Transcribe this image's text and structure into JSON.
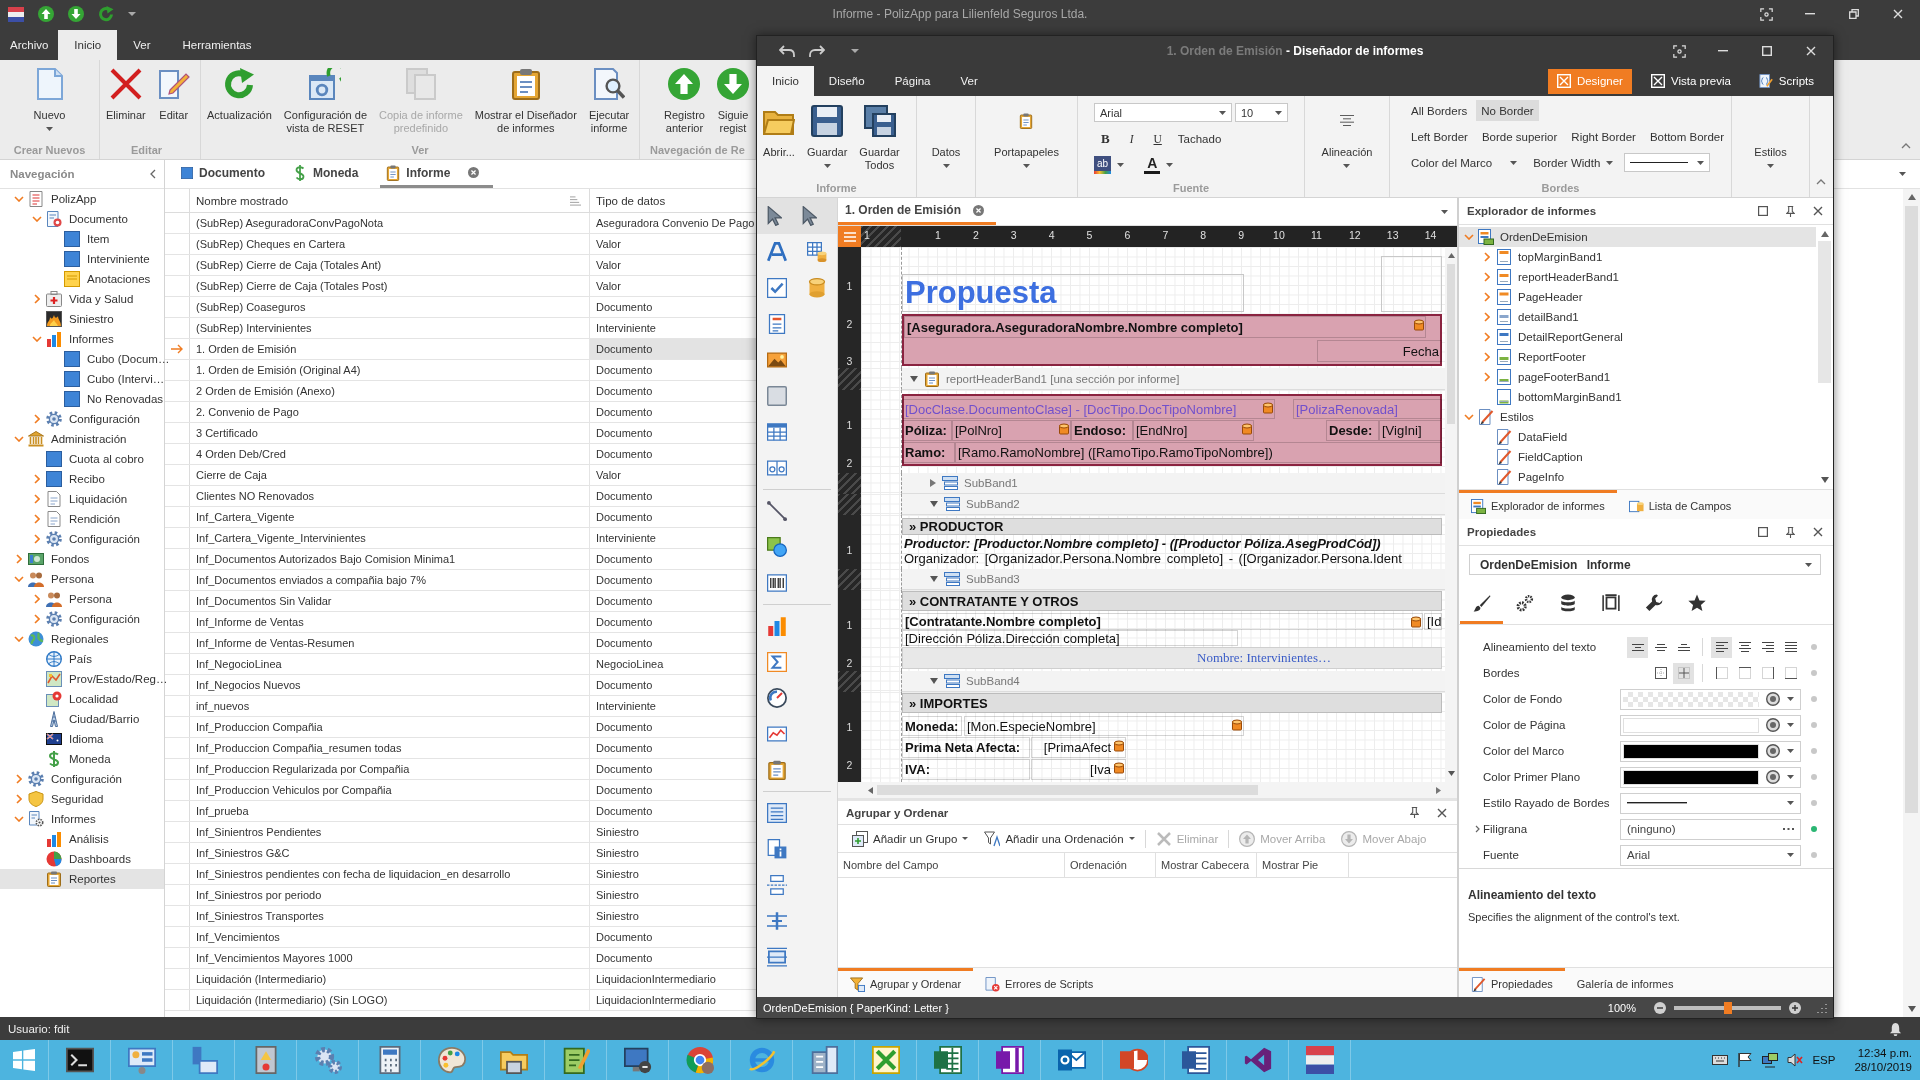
{
  "main_window": {
    "title": "Informe - PolizApp para Lilienfeld Seguros Ltda.",
    "ribbon_tabs": [
      {
        "label": "Archivo",
        "selected": false
      },
      {
        "label": "Inicio",
        "selected": true
      },
      {
        "label": "Ver",
        "selected": false
      },
      {
        "label": "Herramientas",
        "selected": false
      }
    ],
    "ribbon_groups": [
      {
        "title": "Crear Nuevos",
        "buttons": [
          {
            "label": "Nuevo",
            "dropdown": true,
            "disabled": false
          }
        ]
      },
      {
        "title": "Editar",
        "buttons": [
          {
            "label": "Eliminar",
            "disabled": false
          },
          {
            "label": "Editar",
            "disabled": false
          }
        ]
      },
      {
        "title": "Ver",
        "buttons": [
          {
            "label": "Actualización",
            "disabled": false
          },
          {
            "label": "Configuración de\nvista de RESET",
            "disabled": false
          },
          {
            "label": "Copia de informe\npredefinido",
            "disabled": true
          },
          {
            "label": "Mostrar el Diseñador\nde informes",
            "disabled": false
          },
          {
            "label": "Ejecutar\ninforme",
            "disabled": false
          }
        ]
      },
      {
        "title": "Navegación de Re",
        "buttons": [
          {
            "label": "Registro\nanterior",
            "disabled": false
          },
          {
            "label": "Siguie\nregist",
            "disabled": false
          }
        ]
      }
    ],
    "navigation": {
      "title": "Navegación",
      "tree": [
        {
          "label": "PolizApp",
          "expanded": true,
          "selected": false,
          "children": [
            {
              "label": "Documento",
              "expanded": true,
              "selected": false,
              "children": [
                {
                  "label": "Item",
                  "selected": false
                },
                {
                  "label": "Interviniente",
                  "selected": false
                },
                {
                  "label": "Anotaciones",
                  "selected": false
                }
              ]
            },
            {
              "label": "Vida y Salud",
              "expanded": false,
              "selected": false
            },
            {
              "label": "Siniestro",
              "selected": false
            },
            {
              "label": "Informes",
              "expanded": true,
              "selected": false,
              "children": [
                {
                  "label": "Cubo (Docum…",
                  "selected": false
                },
                {
                  "label": "Cubo (Intervi…",
                  "selected": false
                },
                {
                  "label": "No Renovadas",
                  "selected": false
                }
              ]
            },
            {
              "label": "Configuración",
              "expanded": false,
              "selected": false
            }
          ]
        },
        {
          "label": "Administración",
          "expanded": true,
          "selected": false,
          "children": [
            {
              "label": "Cuota al cobro",
              "selected": false
            },
            {
              "label": "Recibo",
              "expanded": false,
              "selected": false
            },
            {
              "label": "Liquidación",
              "expanded": false,
              "selected": false
            },
            {
              "label": "Rendición",
              "expanded": false,
              "selected": false
            },
            {
              "label": "Configuración",
              "expanded": false,
              "selected": false
            }
          ]
        },
        {
          "label": "Fondos",
          "expanded": false,
          "selected": false
        },
        {
          "label": "Persona",
          "expanded": true,
          "selected": false,
          "children": [
            {
              "label": "Persona",
              "expanded": false,
              "selected": false
            },
            {
              "label": "Configuración",
              "expanded": false,
              "selected": false
            }
          ]
        },
        {
          "label": "Regionales",
          "expanded": true,
          "selected": false,
          "children": [
            {
              "label": "País",
              "selected": false
            },
            {
              "label": "Prov/Estado/Reg…",
              "selected": false
            },
            {
              "label": "Localidad",
              "selected": false
            },
            {
              "label": "Ciudad/Barrio",
              "selected": false
            },
            {
              "label": "Idioma",
              "selected": false
            },
            {
              "label": "Moneda",
              "selected": false
            }
          ]
        },
        {
          "label": "Configuración",
          "expanded": false,
          "selected": false
        },
        {
          "label": "Seguridad",
          "expanded": false,
          "selected": false
        },
        {
          "label": "Informes",
          "expanded": true,
          "selected": false,
          "children": [
            {
              "label": "Análisis",
              "selected": false
            },
            {
              "label": "Dashboards",
              "selected": false
            },
            {
              "label": "Reportes",
              "selected": true
            }
          ]
        }
      ]
    },
    "document_tabs": [
      {
        "label": "Documento",
        "selected": false,
        "closable": false
      },
      {
        "label": "Moneda",
        "selected": false,
        "closable": false
      },
      {
        "label": "Informe",
        "selected": true,
        "closable": true
      }
    ],
    "grid": {
      "columns": [
        "Nombre mostrado",
        "Tipo de datos"
      ],
      "rows": [
        {
          "name": "(SubRep) AseguradoraConvPagoNota",
          "type": "Aseguradora Convenio De Pago",
          "selected": false
        },
        {
          "name": "(SubRep) Cheques en Cartera",
          "type": "Valor",
          "selected": false
        },
        {
          "name": "(SubRep) Cierre de Caja (Totales Ant)",
          "type": "Valor",
          "selected": false
        },
        {
          "name": "(SubRep) Cierre de Caja (Totales Post)",
          "type": "Valor",
          "selected": false
        },
        {
          "name": "(SubRep) Coaseguros",
          "type": "Documento",
          "selected": false
        },
        {
          "name": "(SubRep) Intervinientes",
          "type": "Interviniente",
          "selected": false
        },
        {
          "name": "1. Orden de Emisión",
          "type": "Documento",
          "selected": true
        },
        {
          "name": "1. Orden de Emisión (Original A4)",
          "type": "Documento",
          "selected": false
        },
        {
          "name": "2 Orden de Emisión (Anexo)",
          "type": "Documento",
          "selected": false
        },
        {
          "name": "2. Convenio de Pago",
          "type": "Documento",
          "selected": false
        },
        {
          "name": "3 Certificado",
          "type": "Documento",
          "selected": false
        },
        {
          "name": "4 Orden Deb/Cred",
          "type": "Documento",
          "selected": false
        },
        {
          "name": "Cierre de Caja",
          "type": "Valor",
          "selected": false
        },
        {
          "name": "Clientes NO Renovados",
          "type": "Documento",
          "selected": false
        },
        {
          "name": "Inf_Cartera_Vigente",
          "type": "Documento",
          "selected": false
        },
        {
          "name": "Inf_Cartera_Vigente_Intervinientes",
          "type": "Interviniente",
          "selected": false
        },
        {
          "name": "Inf_Documentos Autorizados Bajo Comision Minima1",
          "type": "Documento",
          "selected": false
        },
        {
          "name": "Inf_Documentos enviados a compañia bajo 7%",
          "type": "Documento",
          "selected": false
        },
        {
          "name": "Inf_Documentos Sin Validar",
          "type": "Documento",
          "selected": false
        },
        {
          "name": "Inf_Informe de Ventas",
          "type": "Documento",
          "selected": false
        },
        {
          "name": "Inf_Informe de Ventas-Resumen",
          "type": "Documento",
          "selected": false
        },
        {
          "name": "Inf_NegocioLinea",
          "type": "NegocioLinea",
          "selected": false
        },
        {
          "name": "Inf_Negocios Nuevos",
          "type": "Documento",
          "selected": false
        },
        {
          "name": "inf_nuevos",
          "type": "Interviniente",
          "selected": false
        },
        {
          "name": "Inf_Produccion Compañia",
          "type": "Documento",
          "selected": false
        },
        {
          "name": "Inf_Produccion Compañia_resumen todas",
          "type": "Documento",
          "selected": false
        },
        {
          "name": "Inf_Produccion Regularizada por Compañia",
          "type": "Documento",
          "selected": false
        },
        {
          "name": "Inf_Produccion Vehiculos por Compañia",
          "type": "Documento",
          "selected": false
        },
        {
          "name": "Inf_prueba",
          "type": "Documento",
          "selected": false
        },
        {
          "name": "Inf_Sinientros Pendientes",
          "type": "Siniestro",
          "selected": false
        },
        {
          "name": "Inf_Siniestros G&C",
          "type": "Siniestro",
          "selected": false
        },
        {
          "name": "Inf_Siniestros pendientes con fecha de liquidacion_en desarrollo",
          "type": "Siniestro",
          "selected": false
        },
        {
          "name": "Inf_Siniestros por periodo",
          "type": "Siniestro",
          "selected": false
        },
        {
          "name": "Inf_Siniestros Transportes",
          "type": "Siniestro",
          "selected": false
        },
        {
          "name": "Inf_Vencimientos",
          "type": "Documento",
          "selected": false
        },
        {
          "name": "Inf_Vencimientos Mayores 1000",
          "type": "Documento",
          "selected": false
        },
        {
          "name": "Liquidación (Intermediario)",
          "type": "LiquidacionIntermediario",
          "selected": false
        },
        {
          "name": "Liquidación (Intermediario) (Sin LOGO)",
          "type": "LiquidacionIntermediario",
          "selected": false
        }
      ]
    },
    "status_bar": "Usuario: fdit"
  },
  "designer_window": {
    "title": {
      "document": "1. Orden de Emisión",
      "application": "- Diseñador de informes"
    },
    "tabs": [
      {
        "label": "Inicio",
        "selected": true
      },
      {
        "label": "Diseño",
        "selected": false
      },
      {
        "label": "Página",
        "selected": false
      },
      {
        "label": "Ver",
        "selected": false
      }
    ],
    "view_modes": [
      {
        "label": "Designer",
        "selected": true
      },
      {
        "label": "Vista previa",
        "selected": false
      },
      {
        "label": "Scripts",
        "selected": false
      }
    ],
    "ribbon_groups": [
      {
        "kind": "buttons",
        "title": "Informe",
        "buttons": [
          {
            "label": "Abrir..."
          },
          {
            "label": "Guardar",
            "dropdown": true
          },
          {
            "label": "Guardar\nTodos"
          }
        ]
      },
      {
        "kind": "buttons",
        "buttons": [
          {
            "label": "Datos",
            "dropdown": true
          }
        ]
      },
      {
        "kind": "buttons",
        "buttons": [
          {
            "label": "Portapapeles",
            "dropdown": true
          }
        ]
      },
      {
        "kind": "font",
        "title": "Fuente",
        "font": "Arial",
        "size": "10",
        "styles": [
          "B",
          "I",
          "U",
          "Tachado"
        ],
        "highlight_label": "ab",
        "font_color_label": "A"
      },
      {
        "kind": "buttons",
        "buttons": [
          {
            "label": "Alineación",
            "dropdown": true
          }
        ]
      },
      {
        "kind": "borders",
        "title": "Bordes",
        "presets": [
          {
            "label": "All Borders",
            "selected": false
          },
          {
            "label": "No Border",
            "selected": true
          }
        ],
        "sides": [
          "Left Border",
          "Borde superior",
          "Right Border",
          "Bottom Border"
        ],
        "menus": [
          "Color del Marco",
          "Border Width"
        ]
      },
      {
        "kind": "buttons",
        "buttons": [
          {
            "label": "Estilos",
            "dropdown": true
          }
        ]
      }
    ],
    "surface": {
      "tab": {
        "label": "1. Orden de Emisión",
        "selected": true
      },
      "ruler": [
        "1",
        "1",
        "2",
        "3",
        "4",
        "5",
        "6",
        "7",
        "8",
        "9",
        "10",
        "11",
        "12",
        "13",
        "14"
      ],
      "top_section": {
        "ruler": [
          "1",
          "2",
          "3"
        ],
        "controls": [
          {
            "kind": "title",
            "text": "Propuesta"
          },
          {
            "kind": "frame"
          },
          {
            "kind": "panel"
          },
          {
            "kind": "strong",
            "text": "[Aseguradora.AseguradoraNombre.Nombre completo]",
            "bound": true
          },
          {
            "kind": "text",
            "text": "Fecha",
            "align_right": true
          }
        ]
      },
      "bands": [
        {
          "label": "reportHeaderBand1 [una sección por informe]",
          "expanded": true,
          "ruler": [
            "1",
            "2"
          ],
          "controls": [
            {
              "kind": "panel"
            },
            {
              "kind": "expression",
              "text": "[DocClase.DocumentoClase] - [DocTipo.DocTipoNombre]",
              "bound": true
            },
            {
              "kind": "expression",
              "text": "[PolizaRenovada]"
            },
            {
              "kind": "strong",
              "text": "Póliza:"
            },
            {
              "kind": "text",
              "text": "[PolNro]",
              "bound": true
            },
            {
              "kind": "strong",
              "text": "Endoso:"
            },
            {
              "kind": "text",
              "text": "[EndNro]",
              "bound": true
            },
            {
              "kind": "strong",
              "text": "Desde:"
            },
            {
              "kind": "text",
              "text": "[VigIni]"
            },
            {
              "kind": "strong",
              "text": "Ramo:"
            },
            {
              "kind": "text",
              "text": "[Ramo.RamoNombre] ([RamoTipo.RamoTipoNombre])"
            }
          ],
          "sub_bands": [
            {
              "label": "SubBand1",
              "expanded": false
            },
            {
              "label": "SubBand2",
              "expanded": true,
              "ruler": [
                "1"
              ],
              "controls": [
                {
                  "kind": "heading",
                  "text": "» PRODUCTOR"
                },
                {
                  "kind": "italic",
                  "text": "Productor: [Productor.Nombre completo] - ([Productor Póliza.AsegProdCód])"
                },
                {
                  "kind": "plain",
                  "text": "Organizador: [Organizador.Persona.Nombre completo] - ([Organizador.Persona.Ident"
                }
              ]
            },
            {
              "label": "SubBand3",
              "expanded": true,
              "ruler": [
                "1",
                "2"
              ],
              "controls": [
                {
                  "kind": "heading",
                  "text": "» CONTRATANTE Y OTROS"
                },
                {
                  "kind": "strong",
                  "text": "[Contratante.Nombre completo]",
                  "bound": true
                },
                {
                  "kind": "text",
                  "text": "[Id"
                },
                {
                  "kind": "text",
                  "text": "[Dirección Póliza.Dirección completa]"
                },
                {
                  "kind": "serif",
                  "text": "Nombre: Intervinientes…"
                }
              ]
            },
            {
              "label": "SubBand4",
              "expanded": true,
              "ruler": [
                "1",
                "2"
              ],
              "controls": [
                {
                  "kind": "heading",
                  "text": "» IMPORTES"
                },
                {
                  "kind": "strong",
                  "text": "Moneda:"
                },
                {
                  "kind": "text",
                  "text": "[Mon.EspecieNombre]",
                  "bound": true
                },
                {
                  "kind": "strong",
                  "text": "Prima Neta Afecta:"
                },
                {
                  "kind": "text",
                  "text": "[PrimaAfect",
                  "align_right": true,
                  "bound": true
                },
                {
                  "kind": "strong",
                  "text": "IVA:"
                },
                {
                  "kind": "text",
                  "text": "[Iva",
                  "align_right": true,
                  "bound": true
                }
              ]
            }
          ]
        }
      ]
    },
    "group_sort": {
      "title": "Agrupar y Ordenar",
      "toolbar": [
        {
          "label": "Añadir un Grupo",
          "dropdown": true,
          "disabled": false
        },
        {
          "label": "Añadir una Ordenación",
          "dropdown": true,
          "disabled": false
        },
        {
          "label": "Eliminar",
          "disabled": true
        },
        {
          "label": "Mover Arriba",
          "disabled": true
        },
        {
          "label": "Mover Abajo",
          "disabled": true
        }
      ],
      "columns": [
        "Nombre del Campo",
        "Ordenación",
        "Mostrar Cabecera",
        "Mostrar Pie"
      ]
    },
    "bottom_tabs": [
      {
        "label": "Agrupar y Ordenar",
        "selected": true
      },
      {
        "label": "Errores de Scripts",
        "selected": false
      }
    ],
    "explorer": {
      "title": "Explorador de informes",
      "tree": [
        {
          "label": "OrdenDeEmision",
          "expanded": true,
          "selected": true,
          "children": [
            {
              "label": "topMarginBand1",
              "expanded": false,
              "selected": false
            },
            {
              "label": "reportHeaderBand1",
              "expanded": false,
              "selected": false
            },
            {
              "label": "PageHeader",
              "expanded": false,
              "selected": false
            },
            {
              "label": "detailBand1",
              "expanded": false,
              "selected": false
            },
            {
              "label": "DetailReportGeneral",
              "expanded": false,
              "selected": false
            },
            {
              "label": "ReportFooter",
              "expanded": false,
              "selected": false
            },
            {
              "label": "pageFooterBand1",
              "expanded": false,
              "selected": false
            },
            {
              "label": "bottomMarginBand1",
              "selected": false
            }
          ]
        },
        {
          "label": "Estilos",
          "expanded": true,
          "selected": false,
          "children": [
            {
              "label": "DataField",
              "selected": false
            },
            {
              "label": "FieldCaption",
              "selected": false
            },
            {
              "label": "PageInfo",
              "selected": false
            }
          ]
        }
      ],
      "tabs": [
        {
          "label": "Explorador de informes",
          "selected": true
        },
        {
          "label": "Lista de Campos",
          "selected": false
        }
      ]
    },
    "properties": {
      "title": "Propiedades",
      "object_name": "OrdenDeEmision",
      "object_type": "Informe",
      "tabs": [
        {
          "selected": true
        },
        {
          "selected": false
        },
        {
          "selected": false
        },
        {
          "selected": false
        },
        {
          "selected": false
        },
        {
          "selected": false
        }
      ],
      "rows": [
        {
          "label": "Alineamiento del texto",
          "kind": "alignment",
          "vertical": [
            {
              "selected": true
            },
            {
              "selected": false
            },
            {
              "selected": false
            }
          ],
          "horizontal": [
            {
              "selected": true
            },
            {
              "selected": false
            },
            {
              "selected": false
            },
            {
              "selected": false
            }
          ],
          "modified": false
        },
        {
          "label": "Bordes",
          "kind": "borders",
          "options": [
            {
              "selected": false
            },
            {
              "selected": true
            },
            {
              "selected": false
            },
            {
              "selected": false
            },
            {
              "selected": false
            },
            {
              "selected": false
            }
          ],
          "modified": false
        },
        {
          "label": "Color de Fondo",
          "kind": "color",
          "transparent": true,
          "modified": false
        },
        {
          "label": "Color de Página",
          "kind": "color",
          "color": "#ffffff",
          "modified": false
        },
        {
          "label": "Color del Marco",
          "kind": "color",
          "color": "#000000",
          "modified": false
        },
        {
          "label": "Color Primer Plano",
          "kind": "color",
          "color": "#000000",
          "modified": false
        },
        {
          "label": "Estilo Rayado de Bordes",
          "kind": "line",
          "modified": false
        },
        {
          "label": "Filigrana",
          "kind": "editor",
          "value": "(ninguno)",
          "expanded": false,
          "modified": true
        },
        {
          "label": "Fuente",
          "kind": "dropdown",
          "value": "Arial",
          "modified": false
        }
      ],
      "description_title": "Alineamiento del texto",
      "description": "Specifies the alignment of the control's text.",
      "bottom_tabs": [
        {
          "label": "Propiedades",
          "selected": true
        },
        {
          "label": "Galería de informes",
          "selected": false
        }
      ]
    },
    "status_bar": {
      "text": "OrdenDeEmision { PaperKind: Letter }",
      "zoom": "100%",
      "zoom_slider": {
        "level": 0.5
      }
    }
  },
  "taskbar": {
    "language": "ESP",
    "time": "12:34 p.m.",
    "date": "28/10/2019"
  }
}
